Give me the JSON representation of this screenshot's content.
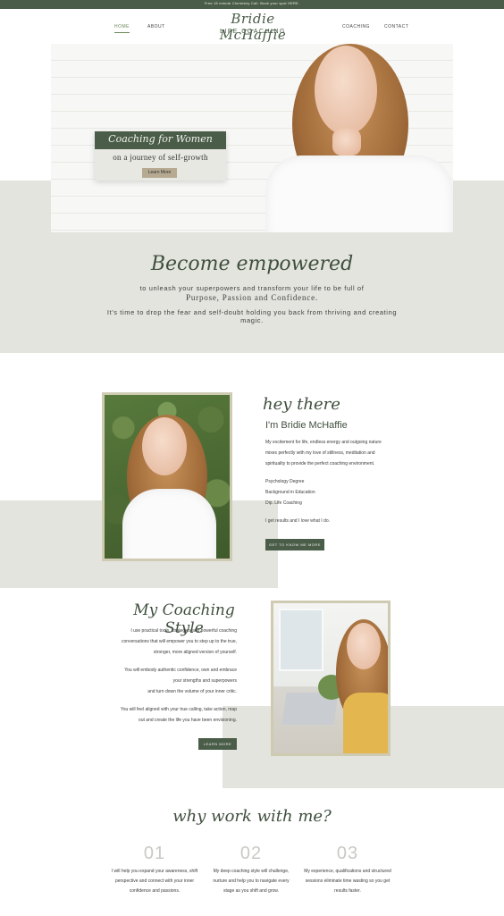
{
  "topbar": {
    "text": "Free 15 minute Chemistry Call. Book your spot HERE."
  },
  "nav": {
    "home": "HOME",
    "about": "ABOUT",
    "coaching": "COACHING",
    "contact": "CONTACT"
  },
  "logo": {
    "script": "Bridie McHaffie",
    "sub": "LIFE COACHING"
  },
  "hero": {
    "title": "Coaching for Women",
    "subtitle": "on a journey of self-growth",
    "button": "Learn More"
  },
  "empower": {
    "heading": "Become empowered",
    "line1": "to unleash your superpowers and transform your life to be full of",
    "line2": "Purpose, Passion and Confidence.",
    "line3": "It's time to drop the fear and self-doubt holding you back from thriving and creating",
    "line4": "magic."
  },
  "about": {
    "script": "hey there",
    "name": "I'm Bridie McHaffie",
    "p1": "My excitement for life, endless energy and outgoing nature",
    "p2": "mixes perfectly with my love of stillness, meditation and",
    "p3": "spirituality to provide the perfect coaching environment.",
    "q1": "Psychology Degree",
    "q2": "Background in Education",
    "q3": "Dip. Life Coaching",
    "closing": "I get results and I love what I do.",
    "button": "GET TO KNOW ME MORE"
  },
  "style": {
    "heading": "My Coaching Style",
    "l1": "I use practical tools, strategies and powerful coaching",
    "l2": "conversations that will empower you to step up to the true,",
    "l3": "stronger, more aligned version of yourself.",
    "l4": "You will embody authentic confidence, own and embrace",
    "l5": "your strengths and superpowers",
    "l6": "and turn down the volume of your inner critic.",
    "l7": "You will feel aligned with your true calling, take action, map",
    "l8": "out and create the life you have been envisioning.",
    "button": "LEARN MORE"
  },
  "why": {
    "heading": "why work with me?",
    "items": [
      {
        "num": "01",
        "l1": "I will help you expand your awareness, shift",
        "l2": "perspective and connect with your inner",
        "l3": "confidence and passions."
      },
      {
        "num": "02",
        "l1": "My deep coaching style will challenge,",
        "l2": "nurture and help you to navigate every",
        "l3": "stage as you shift and grow."
      },
      {
        "num": "03",
        "l1": "My experience, qualifications and structured",
        "l2": "sessions eliminate time wasting so you get",
        "l3": "results faster."
      }
    ]
  }
}
